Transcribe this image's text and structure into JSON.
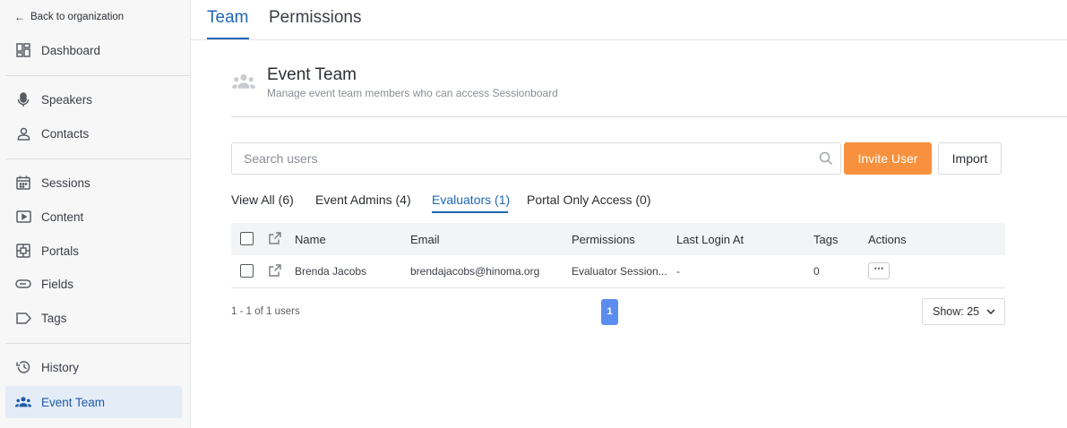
{
  "sidebar": {
    "back_label": "Back to organization",
    "items": [
      {
        "label": "Dashboard",
        "icon": "dashboard-icon"
      },
      {
        "label": "Speakers",
        "icon": "microphone-icon"
      },
      {
        "label": "Contacts",
        "icon": "person-icon"
      },
      {
        "label": "Sessions",
        "icon": "calendar-icon"
      },
      {
        "label": "Content",
        "icon": "video-play-icon"
      },
      {
        "label": "Portals",
        "icon": "portal-grid-icon"
      },
      {
        "label": "Fields",
        "icon": "toggle-field-icon"
      },
      {
        "label": "Tags",
        "icon": "tag-icon"
      },
      {
        "label": "History",
        "icon": "history-icon"
      },
      {
        "label": "Event Team",
        "icon": "team-icon",
        "active": true
      }
    ]
  },
  "top_tabs": [
    {
      "label": "Team",
      "active": true
    },
    {
      "label": "Permissions",
      "active": false
    }
  ],
  "header": {
    "title": "Event Team",
    "subtitle": "Manage event team members who can access Sessionboard"
  },
  "search": {
    "placeholder": "Search users",
    "value": ""
  },
  "buttons": {
    "invite": "Invite User",
    "import": "Import"
  },
  "filter_tabs": [
    {
      "label": "View All (6)",
      "active": false
    },
    {
      "label": "Event Admins (4)",
      "active": false
    },
    {
      "label": "Evaluators (1)",
      "active": true
    },
    {
      "label": "Portal Only Access (0)",
      "active": false
    }
  ],
  "table": {
    "columns": [
      "Name",
      "Email",
      "Permissions",
      "Last Login At",
      "Tags",
      "Actions"
    ],
    "rows": [
      {
        "name": "Brenda Jacobs",
        "email": "brendajacobs@hinoma.org",
        "permissions": "Evaluator Session...",
        "last_login": "-",
        "tags": "0",
        "actions": "⋯"
      }
    ]
  },
  "footer": {
    "count": "1 - 1 of 1 users",
    "current_page": "1",
    "show_label": "Show: 25"
  },
  "colors": {
    "accent": "#1e66b4",
    "invite_button": "#f7913d",
    "page_button": "#5b8def",
    "active_nav_bg": "#e3ecf7"
  }
}
